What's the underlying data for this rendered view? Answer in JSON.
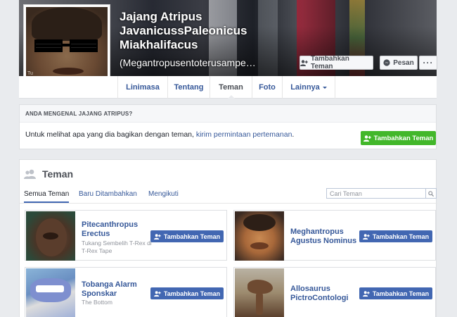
{
  "profile": {
    "name": "Jajang Atripus JavanicussPaleonicus Miakhalifacus",
    "alternate_name": "(Megantropusentoterusampe…",
    "avatar_overlay_text": "Tu"
  },
  "cover_actions": {
    "add_friend_label": "Tambahkan Teman",
    "message_label": "Pesan",
    "more_label": "···"
  },
  "nav": {
    "tabs": [
      {
        "label": "Linimasa"
      },
      {
        "label": "Tentang"
      },
      {
        "label": "Teman"
      },
      {
        "label": "Foto"
      },
      {
        "label": "Lainnya"
      }
    ],
    "active": "Teman"
  },
  "know_box": {
    "header": "ANDA MENGENAL JAJANG ATRIPUS?",
    "message_prefix": "Untuk melihat apa yang dia bagikan dengan teman, ",
    "message_link": "kirim permintaan pertemanan",
    "message_suffix": ".",
    "button_label": "Tambahkan Teman"
  },
  "friends": {
    "title": "Teman",
    "subtabs": [
      {
        "label": "Semua Teman"
      },
      {
        "label": "Baru Ditambahkan"
      },
      {
        "label": "Mengikuti"
      }
    ],
    "search_placeholder": "Cari Teman",
    "items": [
      {
        "name": "Pitecanthropus Erectus",
        "subtitle": "Tukang Sembelih T-Rex di T-Rex Tape",
        "button_label": "Tambahkan Teman"
      },
      {
        "name": "Meghantropus Agustus Nominus",
        "subtitle": "",
        "button_label": "Tambahkan Teman"
      },
      {
        "name": "Tobanga Alarm Sponskar",
        "subtitle": "The Bottom",
        "button_label": "Tambahkan Teman"
      },
      {
        "name": "Allosaurus PictroContologi",
        "subtitle": "",
        "button_label": "Tambahkan Teman"
      }
    ]
  },
  "colors": {
    "link_blue": "#365899",
    "button_blue": "#4267b2",
    "button_green": "#42b72a",
    "page_bg": "#e9ebee"
  },
  "icons": [
    "add-friend-icon",
    "message-icon",
    "caret-down-icon",
    "friends-icon",
    "search-icon"
  ]
}
